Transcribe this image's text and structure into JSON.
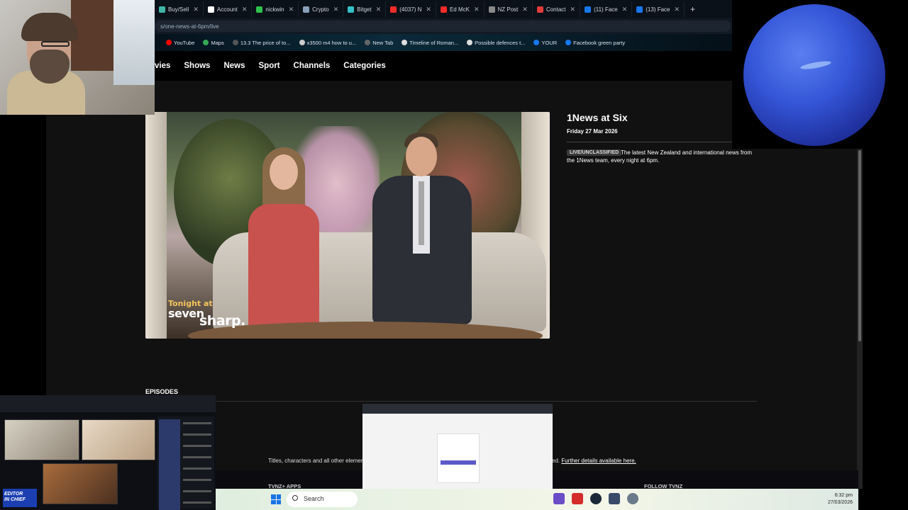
{
  "tabs": [
    {
      "label": "Buy/Sell",
      "color": "#3fb6a8"
    },
    {
      "label": "Account",
      "color": "#ffffff"
    },
    {
      "label": "nickwin",
      "color": "#2ec14c"
    },
    {
      "label": "Crypto",
      "color": "#8aa0b8"
    },
    {
      "label": "Bitget",
      "color": "#34c0c6"
    },
    {
      "label": "(4037) N",
      "color": "#ff2b2b"
    },
    {
      "label": "Ed McK",
      "color": "#ff2b2b"
    },
    {
      "label": "NZ Post",
      "color": "#8a8a8a"
    },
    {
      "label": "Contact",
      "color": "#e23b3b"
    },
    {
      "label": "(11) Face",
      "color": "#1877f2"
    },
    {
      "label": "(13) Face",
      "color": "#1877f2"
    }
  ],
  "url": "s/one-news-at-6pm/live",
  "bookmarks": [
    {
      "label": "YouTube",
      "color": "#ff0000"
    },
    {
      "label": "Maps",
      "color": "#34a853"
    },
    {
      "label": "13.3 The price of to...",
      "color": "#555555"
    },
    {
      "label": "x3500 m4 how to u...",
      "color": "#cccccc"
    },
    {
      "label": "New Tab",
      "color": "#666666"
    },
    {
      "label": "Timeline of Roman...",
      "color": "#dddddd"
    },
    {
      "label": "Possible defences t...",
      "color": "#dddddd"
    },
    {
      "label": "YOUR",
      "color": "#1877f2"
    },
    {
      "label": "Facebook green party",
      "color": "#1877f2"
    }
  ],
  "nav": [
    "vies",
    "Shows",
    "News",
    "Sport",
    "Channels",
    "Categories"
  ],
  "video_logo": {
    "line1": "Tonight at",
    "line2": "seven",
    "line3": "sharp."
  },
  "show": {
    "title": "1News at Six",
    "date": "Friday 27 Mar 2026",
    "badge": "LIVE/UNCLASSIFIED",
    "description": "The latest New Zealand and international news from the 1News team, every night at 6pm."
  },
  "episodes_label": "EPISODES",
  "footer": {
    "text_left": "Titles, characters and all other element",
    "text_right": "ed.",
    "link": "Further details available here.",
    "apps_label": "TVNZ+ APPS",
    "follow_label": "FOLLOW TVNZ"
  },
  "call_overlay": {
    "badge_line1": "EDITOR",
    "badge_line2": "IN CHIEF"
  },
  "taskbar": {
    "search_placeholder": "Search",
    "time": "6:32 pm",
    "date": "27/03/2026"
  }
}
